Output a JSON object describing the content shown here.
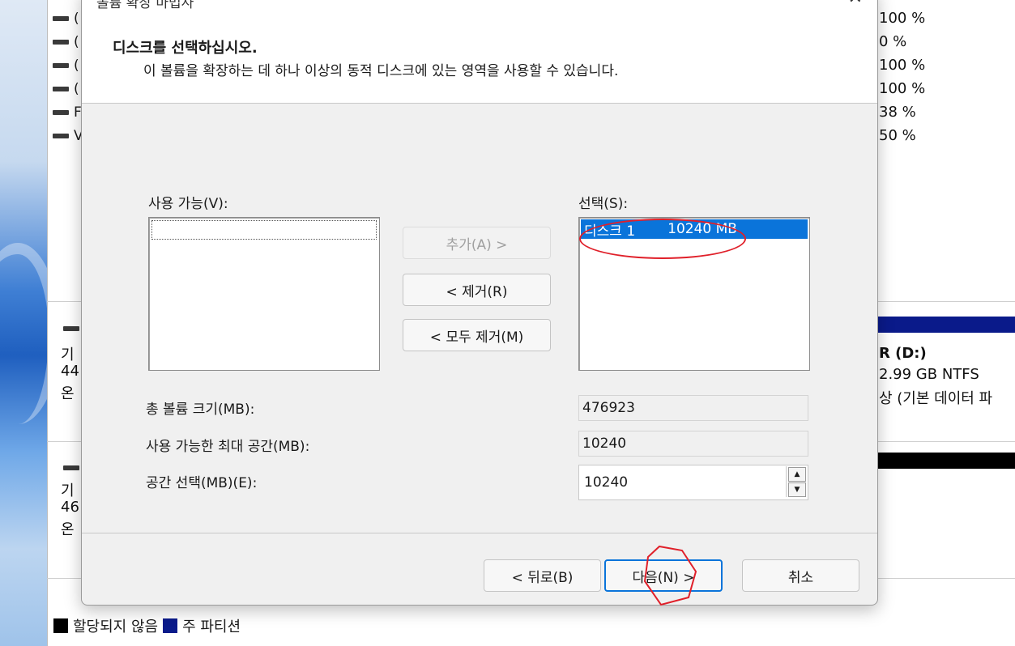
{
  "background": {
    "percentages": [
      "100 %",
      "0 %",
      "100 %",
      "100 %",
      "38 %",
      "50 %"
    ],
    "list_row_fragments": [
      "(",
      "(",
      "(",
      "(",
      "F",
      "V"
    ],
    "disk1_fragments": [
      "기",
      "44",
      "온"
    ],
    "disk2_fragments": [
      "기",
      "46",
      "온"
    ],
    "volume_name": "R  (D:)",
    "volume_size": "2.99 GB NTFS",
    "volume_status": "상 (기본 데이터 파",
    "legend": [
      {
        "label": "할당되지 않음",
        "color": "#000000"
      },
      {
        "label": "주 파티션",
        "color": "#0a1a8a"
      }
    ]
  },
  "dialog": {
    "title": "볼륨 확장 마법사",
    "close_glyph": "✕",
    "header_title": "디스크를 선택하십시오.",
    "header_subtitle": "이 볼륨을 확장하는 데 하나 이상의 동적 디스크에 있는 영역을 사용할 수 있습니다.",
    "available_label": "사용 가능(V):",
    "selected_label": "선택(S):",
    "selected_items": [
      {
        "disk": "디스크 1",
        "size": "10240 MB"
      }
    ],
    "add_button": "추가(A) >",
    "remove_button": "< 제거(R)",
    "remove_all_button": "< 모두 제거(M)",
    "total_size_label": "총 볼륨 크기(MB):",
    "total_size_value": "476923",
    "max_space_label": "사용 가능한 최대 공간(MB):",
    "max_space_value": "10240",
    "select_space_label": "공간 선택(MB)(E):",
    "select_space_value": "10240",
    "back_button": "< 뒤로(B)",
    "next_button": "다음(N) >",
    "cancel_button": "취소"
  },
  "colors": {
    "selection": "#0a74da",
    "annotation": "#e0202a"
  }
}
